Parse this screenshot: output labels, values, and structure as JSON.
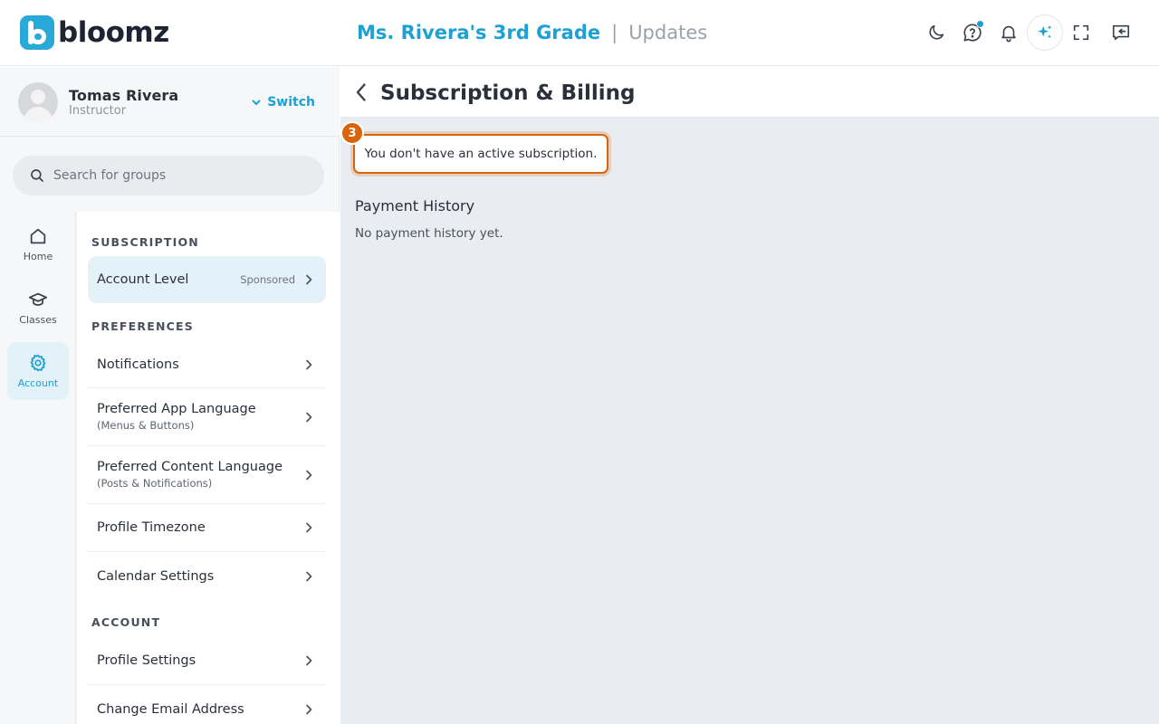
{
  "header": {
    "logo_text": "bloomz",
    "class_name": "Ms. Rivera's 3rd Grade",
    "separator": "|",
    "section": "Updates",
    "icons": [
      "moon-icon",
      "help-chat-icon",
      "bell-icon",
      "ai-sparkle-icon",
      "fullscreen-icon",
      "collapse-panel-icon"
    ],
    "accent_color": "#1da1d4"
  },
  "profile": {
    "name": "Tomas Rivera",
    "role": "Instructor",
    "switch_label": "Switch"
  },
  "search": {
    "placeholder": "Search for groups"
  },
  "rail": [
    {
      "label": "Home",
      "icon": "home-icon",
      "active": false
    },
    {
      "label": "Classes",
      "icon": "graduation-cap-icon",
      "active": false
    },
    {
      "label": "Account",
      "icon": "gear-icon",
      "active": true
    }
  ],
  "settings": {
    "subscription_title": "SUBSCRIPTION",
    "account_level": {
      "label": "Account Level",
      "badge": "Sponsored"
    },
    "preferences_title": "PREFERENCES",
    "notifications": {
      "label": "Notifications"
    },
    "app_language": {
      "label": "Preferred App Language",
      "sub": "(Menus & Buttons)"
    },
    "content_language": {
      "label": "Preferred Content Language",
      "sub": "(Posts & Notifications)"
    },
    "timezone": {
      "label": "Profile Timezone"
    },
    "calendar": {
      "label": "Calendar Settings"
    },
    "account_title": "ACCOUNT",
    "profile_settings": {
      "label": "Profile Settings"
    },
    "change_email": {
      "label": "Change Email Address"
    }
  },
  "main": {
    "title": "Subscription & Billing",
    "step_number": "3",
    "notice": "You don't have an active subscription.",
    "payment_history_title": "Payment History",
    "payment_history_empty": "No payment history yet.",
    "highlight_color": "#d9650b"
  }
}
